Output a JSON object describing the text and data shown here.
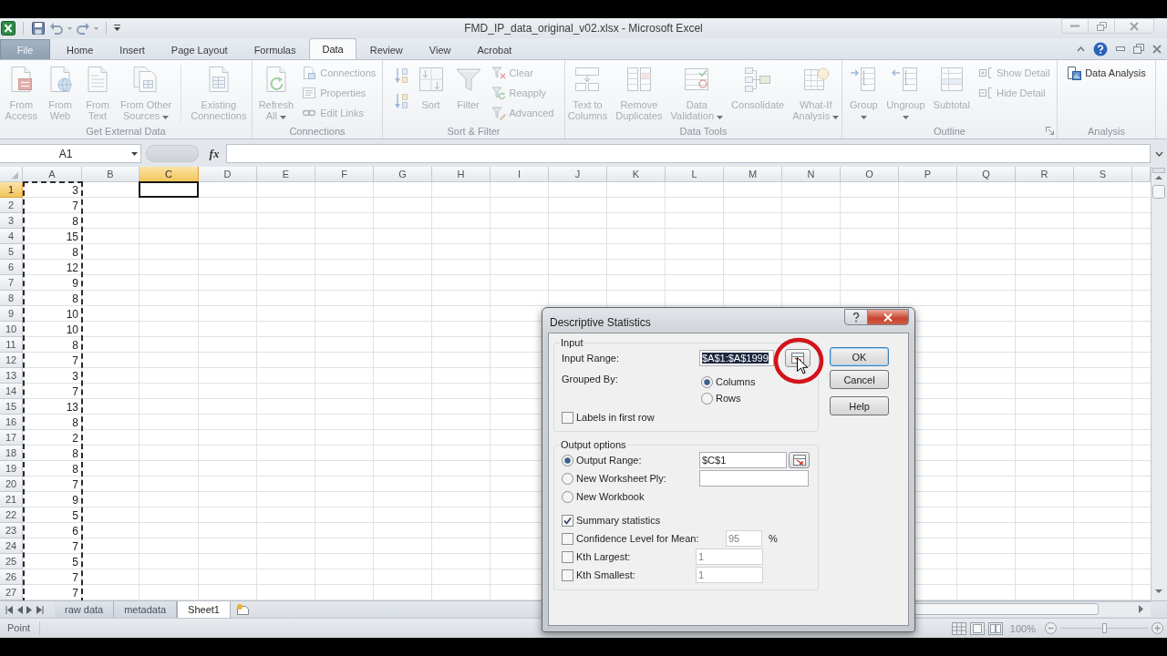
{
  "title_bar": {
    "title": "FMD_IP_data_original_v02.xlsx - Microsoft Excel"
  },
  "ribbon_tabs": [
    {
      "label": "File",
      "kind": "file",
      "selected": false
    },
    {
      "label": "Home",
      "kind": "tab",
      "selected": false
    },
    {
      "label": "Insert",
      "kind": "tab",
      "selected": false
    },
    {
      "label": "Page Layout",
      "kind": "tab",
      "selected": false
    },
    {
      "label": "Formulas",
      "kind": "tab",
      "selected": false
    },
    {
      "label": "Data",
      "kind": "tab",
      "selected": true
    },
    {
      "label": "Review",
      "kind": "tab",
      "selected": false
    },
    {
      "label": "View",
      "kind": "tab",
      "selected": false
    },
    {
      "label": "Acrobat",
      "kind": "tab",
      "selected": false
    }
  ],
  "ribbon_groups": [
    {
      "label": "Get External Data",
      "launcher": false,
      "items": [
        {
          "kind": "large",
          "label": "From\nAccess",
          "disabled": true,
          "menu": false
        },
        {
          "kind": "large",
          "label": "From\nWeb",
          "disabled": true,
          "menu": false
        },
        {
          "kind": "large",
          "label": "From\nText",
          "disabled": true,
          "menu": false
        },
        {
          "kind": "large",
          "label": "From Other\nSources",
          "disabled": true,
          "menu": true
        },
        {
          "kind": "separator"
        },
        {
          "kind": "large",
          "label": "Existing\nConnections",
          "disabled": true,
          "menu": false
        }
      ]
    },
    {
      "label": "Connections",
      "launcher": false,
      "items": [
        {
          "kind": "large",
          "label": "Refresh\nAll",
          "disabled": true,
          "menu": true
        },
        {
          "kind": "stack",
          "items": [
            {
              "label": "Connections",
              "disabled": true
            },
            {
              "label": "Properties",
              "disabled": true
            },
            {
              "label": "Edit Links",
              "disabled": true
            }
          ]
        }
      ]
    },
    {
      "label": "Sort & Filter",
      "launcher": false,
      "items": [
        {
          "kind": "icon-stack",
          "items": [
            {
              "disabled": true
            },
            {
              "disabled": true
            }
          ]
        },
        {
          "kind": "large",
          "label": "Sort",
          "disabled": true,
          "menu": false
        },
        {
          "kind": "large",
          "label": "Filter",
          "disabled": true,
          "menu": false
        },
        {
          "kind": "stack",
          "items": [
            {
              "label": "Clear",
              "disabled": true
            },
            {
              "label": "Reapply",
              "disabled": true
            },
            {
              "label": "Advanced",
              "disabled": true
            }
          ]
        }
      ]
    },
    {
      "label": "Data Tools",
      "launcher": false,
      "items": [
        {
          "kind": "large",
          "label": "Text to\nColumns",
          "disabled": true,
          "menu": false
        },
        {
          "kind": "large",
          "label": "Remove\nDuplicates",
          "disabled": true,
          "menu": false
        },
        {
          "kind": "large",
          "label": "Data\nValidation",
          "disabled": true,
          "menu": true
        },
        {
          "kind": "large",
          "label": "Consolidate",
          "disabled": true,
          "menu": false
        },
        {
          "kind": "large",
          "label": "What-If\nAnalysis",
          "disabled": true,
          "menu": true
        }
      ]
    },
    {
      "label": "Outline",
      "launcher": true,
      "items": [
        {
          "kind": "large",
          "label": "Group",
          "disabled": true,
          "menu": true
        },
        {
          "kind": "large",
          "label": "Ungroup",
          "disabled": true,
          "menu": true
        },
        {
          "kind": "large",
          "label": "Subtotal",
          "disabled": true,
          "menu": false
        },
        {
          "kind": "stack",
          "items": [
            {
              "label": "Show Detail",
              "disabled": true
            },
            {
              "label": "Hide Detail",
              "disabled": true
            }
          ]
        }
      ]
    },
    {
      "label": "Analysis",
      "launcher": false,
      "items": [
        {
          "kind": "stack",
          "items": [
            {
              "label": "Data Analysis",
              "disabled": false
            }
          ]
        }
      ]
    }
  ],
  "formula_bar": {
    "name_box": "A1",
    "function_label": "fx"
  },
  "sheet": {
    "columns": [
      {
        "label": "A",
        "selected": false,
        "in_range": true
      },
      {
        "label": "B",
        "selected": false,
        "in_range": false
      },
      {
        "label": "C",
        "selected": true,
        "in_range": false
      },
      {
        "label": "D",
        "selected": false,
        "in_range": false
      },
      {
        "label": "E",
        "selected": false,
        "in_range": false
      },
      {
        "label": "F",
        "selected": false,
        "in_range": false
      },
      {
        "label": "G",
        "selected": false,
        "in_range": false
      },
      {
        "label": "H",
        "selected": false,
        "in_range": false
      },
      {
        "label": "I",
        "selected": false,
        "in_range": false
      },
      {
        "label": "J",
        "selected": false,
        "in_range": false
      },
      {
        "label": "K",
        "selected": false,
        "in_range": false
      },
      {
        "label": "L",
        "selected": false,
        "in_range": false
      },
      {
        "label": "M",
        "selected": false,
        "in_range": false
      },
      {
        "label": "N",
        "selected": false,
        "in_range": false
      },
      {
        "label": "O",
        "selected": false,
        "in_range": false
      },
      {
        "label": "P",
        "selected": false,
        "in_range": false
      },
      {
        "label": "Q",
        "selected": false,
        "in_range": false
      },
      {
        "label": "R",
        "selected": false,
        "in_range": false
      },
      {
        "label": "S",
        "selected": false,
        "in_range": false
      }
    ],
    "rows": [
      {
        "label": "1",
        "selected": true,
        "cells": [
          "3"
        ]
      },
      {
        "label": "2",
        "selected": false,
        "cells": [
          "7"
        ]
      },
      {
        "label": "3",
        "selected": false,
        "cells": [
          "8"
        ]
      },
      {
        "label": "4",
        "selected": false,
        "cells": [
          "15"
        ]
      },
      {
        "label": "5",
        "selected": false,
        "cells": [
          "8"
        ]
      },
      {
        "label": "6",
        "selected": false,
        "cells": [
          "12"
        ]
      },
      {
        "label": "7",
        "selected": false,
        "cells": [
          "9"
        ]
      },
      {
        "label": "8",
        "selected": false,
        "cells": [
          "8"
        ]
      },
      {
        "label": "9",
        "selected": false,
        "cells": [
          "10"
        ]
      },
      {
        "label": "10",
        "selected": false,
        "cells": [
          "10"
        ]
      },
      {
        "label": "11",
        "selected": false,
        "cells": [
          "8"
        ]
      },
      {
        "label": "12",
        "selected": false,
        "cells": [
          "7"
        ]
      },
      {
        "label": "13",
        "selected": false,
        "cells": [
          "3"
        ]
      },
      {
        "label": "14",
        "selected": false,
        "cells": [
          "7"
        ]
      },
      {
        "label": "15",
        "selected": false,
        "cells": [
          "13"
        ]
      },
      {
        "label": "16",
        "selected": false,
        "cells": [
          "8"
        ]
      },
      {
        "label": "17",
        "selected": false,
        "cells": [
          "2"
        ]
      },
      {
        "label": "18",
        "selected": false,
        "cells": [
          "8"
        ]
      },
      {
        "label": "19",
        "selected": false,
        "cells": [
          "8"
        ]
      },
      {
        "label": "20",
        "selected": false,
        "cells": [
          "7"
        ]
      },
      {
        "label": "21",
        "selected": false,
        "cells": [
          "9"
        ]
      },
      {
        "label": "22",
        "selected": false,
        "cells": [
          "5"
        ]
      },
      {
        "label": "23",
        "selected": false,
        "cells": [
          "6"
        ]
      },
      {
        "label": "24",
        "selected": false,
        "cells": [
          "7"
        ]
      },
      {
        "label": "25",
        "selected": false,
        "cells": [
          "5"
        ]
      },
      {
        "label": "26",
        "selected": false,
        "cells": [
          "7"
        ]
      },
      {
        "label": "27",
        "selected": false,
        "cells": [
          "7"
        ]
      }
    ]
  },
  "sheet_tabs": [
    {
      "label": "raw data",
      "selected": false
    },
    {
      "label": "metadata",
      "selected": false
    },
    {
      "label": "Sheet1",
      "selected": true
    }
  ],
  "status_bar": {
    "mode": "Point",
    "zoom": "100%",
    "zoom_slider": {
      "level": 0.5
    }
  },
  "dialog": {
    "title": "Descriptive Statistics",
    "input_group": {
      "title": "Input",
      "input_range": {
        "label": "Input Range:",
        "value": "$A$1:$A$1999",
        "value_selected": true
      },
      "grouped_by": {
        "label": "Grouped By:",
        "options": [
          {
            "label": "Columns",
            "selected": true
          },
          {
            "label": "Rows",
            "selected": false
          }
        ]
      },
      "labels_in_first_row": {
        "label": "Labels in first row",
        "checked": false
      }
    },
    "output_group": {
      "title": "Output options",
      "destinations": [
        {
          "label": "Output Range:",
          "kind": "range",
          "selected": true,
          "value": "$C$1"
        },
        {
          "label": "New Worksheet Ply:",
          "kind": "field",
          "selected": false
        },
        {
          "label": "New Workbook",
          "kind": "plain",
          "selected": false
        }
      ],
      "options": [
        {
          "label": "Summary statistics",
          "checked": true
        },
        {
          "label": "Confidence Level for Mean:",
          "checked": false,
          "value": "95",
          "unit": "%"
        },
        {
          "label": "Kth Largest:",
          "checked": false,
          "value": "1"
        },
        {
          "label": "Kth Smallest:",
          "checked": false,
          "value": "1"
        }
      ]
    },
    "buttons": [
      {
        "label": "OK",
        "default": true
      },
      {
        "label": "Cancel",
        "default": false
      },
      {
        "label": "Help",
        "default": false
      }
    ]
  }
}
